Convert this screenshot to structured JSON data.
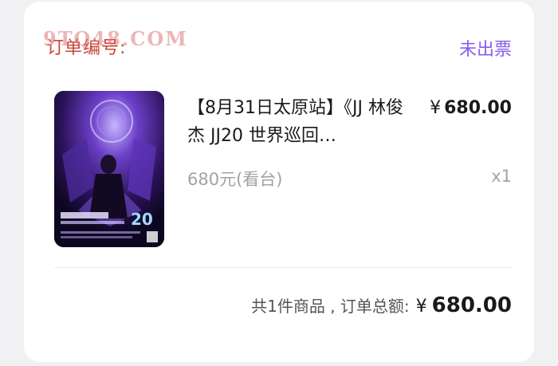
{
  "order": {
    "number_label": "订单编号:",
    "watermark": "9TQ48.COM",
    "status": "未出票"
  },
  "item": {
    "title": "【8月31日太原站】《JJ 林俊杰 JJ20 世界巡回…",
    "price_symbol": "¥",
    "price": "680.00",
    "spec": "680元(看台)",
    "quantity": "x1"
  },
  "summary": {
    "label": "共1件商品 , 订单总额:",
    "total_symbol": "¥",
    "total": "680.00"
  },
  "colors": {
    "status": "#8a5cf0",
    "muted": "#a3a3a3",
    "text": "#1a1a1a"
  }
}
